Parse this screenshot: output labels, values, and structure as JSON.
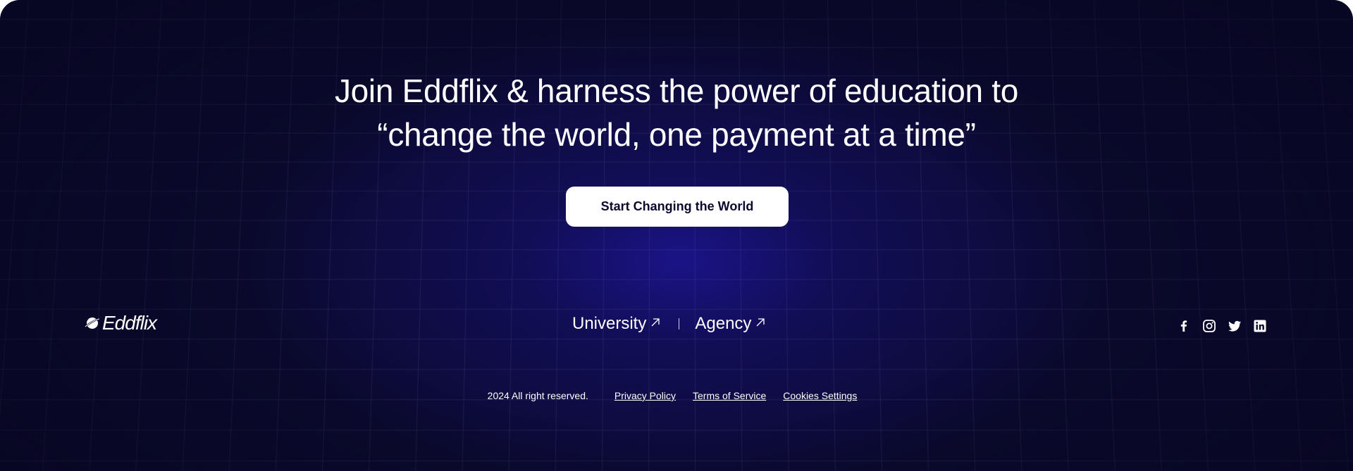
{
  "headline": {
    "line1": "Join Eddflix & harness the power of education to",
    "line2": "“change the world, one payment at a time”"
  },
  "cta": {
    "label": "Start Changing the World"
  },
  "brand": {
    "name": "Eddflix",
    "icon": "planet-logo-icon"
  },
  "nav": {
    "items": [
      {
        "label": "University",
        "icon": "arrow-up-right-icon"
      },
      {
        "label": "Agency",
        "icon": "arrow-up-right-icon"
      }
    ]
  },
  "social": {
    "icons": [
      "facebook-icon",
      "instagram-icon",
      "twitter-icon",
      "linkedin-icon"
    ]
  },
  "legal": {
    "copyright": "2024 All right reserved.",
    "links": [
      "Privacy Policy",
      "Terms of Service",
      "Cookies Settings"
    ]
  },
  "colors": {
    "background": "#0b0a2e",
    "glow": "#1b148c",
    "text": "#ffffff",
    "button_bg": "#ffffff",
    "button_text": "#0b0a2e"
  }
}
